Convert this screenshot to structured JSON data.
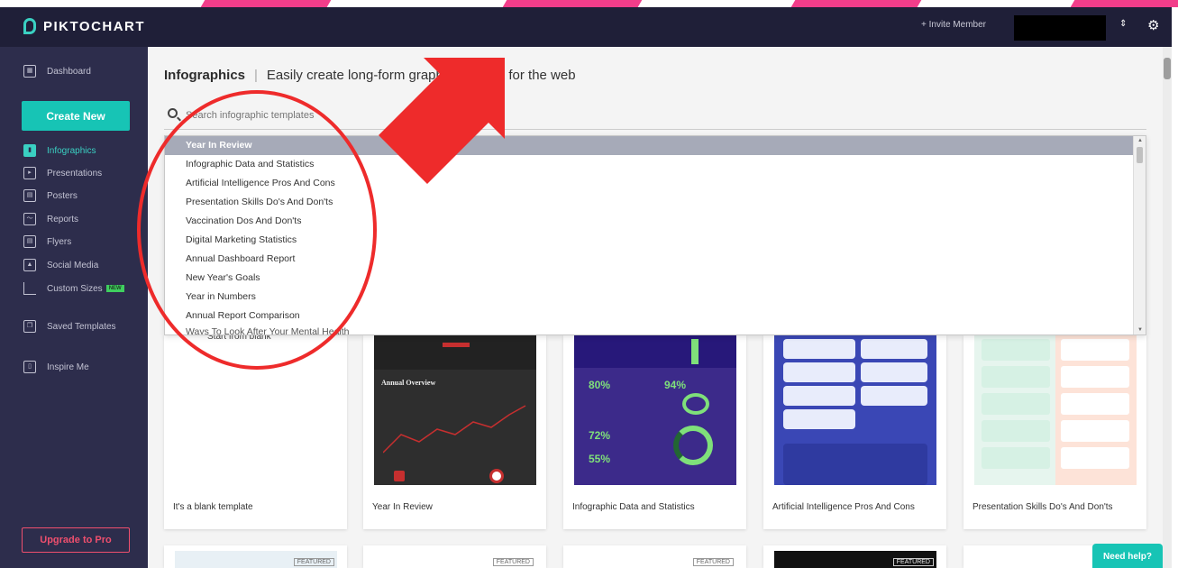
{
  "app": {
    "logo": "PIKTOCHART",
    "invite": "+ Invite Member"
  },
  "sidebar": {
    "dashboard": "Dashboard",
    "create": "Create New",
    "items": [
      {
        "label": "Infographics"
      },
      {
        "label": "Presentations"
      },
      {
        "label": "Posters"
      },
      {
        "label": "Reports"
      },
      {
        "label": "Flyers"
      },
      {
        "label": "Social Media"
      },
      {
        "label": "Custom Sizes",
        "badge": "NEW"
      }
    ],
    "saved": "Saved Templates",
    "inspire": "Inspire Me",
    "upgrade": "Upgrade to Pro"
  },
  "main": {
    "title": "Infographics",
    "subtitle": "Easily create long-form graphics perfect for the web",
    "search_placeholder": "Search infographic templates",
    "dropdown": [
      "Year In Review",
      "Infographic Data and Statistics",
      "Artificial Intelligence Pros And Cons",
      "Presentation Skills Do's And Don'ts",
      "Vaccination Dos And Don'ts",
      "Digital Marketing Statistics",
      "Annual Dashboard Report",
      "New Year's Goals",
      "Year in Numbers",
      "Annual Report Comparison",
      "Ways To Look After Your Mental Health"
    ],
    "cards": [
      {
        "caption": "It's a blank template",
        "thumb_label": "Start from blank"
      },
      {
        "caption": "Year In Review",
        "thumb_label": "Annual Overview"
      },
      {
        "caption": "Infographic Data and Statistics",
        "stat1": "80%",
        "stat2": "94%",
        "stat3": "72%",
        "stat4": "55%"
      },
      {
        "caption": "Artificial Intelligence Pros And Cons"
      },
      {
        "caption": "Presentation Skills Do's And Don'ts"
      }
    ],
    "featured": "FEATURED"
  },
  "help": "Need help?",
  "colors": {
    "accent": "#17c4b5",
    "sidebar": "#2d2d4c",
    "topbar": "#1f1f38",
    "annotation": "#ee2b2b",
    "upgrade": "#ef4f6e"
  }
}
